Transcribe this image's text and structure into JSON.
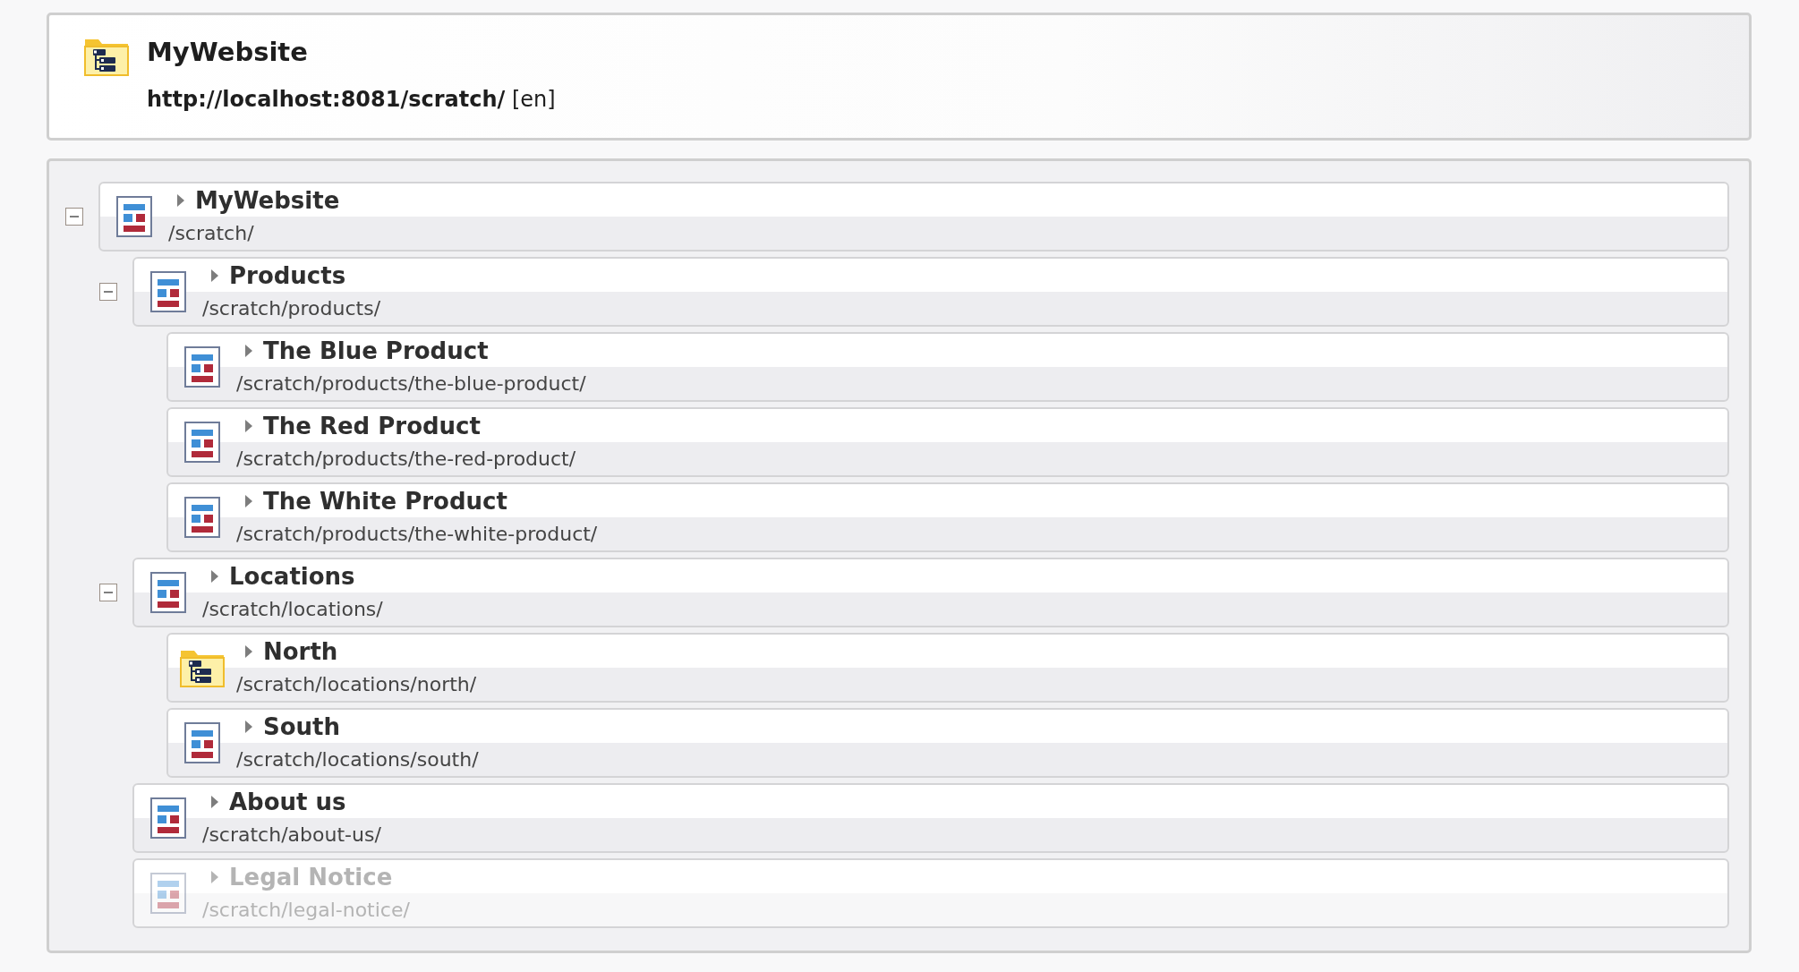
{
  "header": {
    "kind": "folder",
    "title": "MyWebsite",
    "url": "http://localhost:8081/scratch/",
    "language": "[en]"
  },
  "tree": [
    {
      "title": "MyWebsite",
      "path": "/scratch/",
      "kind": "page",
      "disabled": false,
      "expanded": true,
      "children": [
        {
          "title": "Products",
          "path": "/scratch/products/",
          "kind": "page",
          "disabled": false,
          "expanded": true,
          "children": [
            {
              "title": "The Blue Product",
              "path": "/scratch/products/the-blue-product/",
              "kind": "page",
              "disabled": false
            },
            {
              "title": "The Red Product",
              "path": "/scratch/products/the-red-product/",
              "kind": "page",
              "disabled": false
            },
            {
              "title": "The White Product",
              "path": "/scratch/products/the-white-product/",
              "kind": "page",
              "disabled": false
            }
          ]
        },
        {
          "title": "Locations",
          "path": "/scratch/locations/",
          "kind": "page",
          "disabled": false,
          "expanded": true,
          "children": [
            {
              "title": "North",
              "path": "/scratch/locations/north/",
              "kind": "folder",
              "disabled": false
            },
            {
              "title": "South",
              "path": "/scratch/locations/south/",
              "kind": "page",
              "disabled": false
            }
          ]
        },
        {
          "title": "About us",
          "path": "/scratch/about-us/",
          "kind": "page",
          "disabled": false
        },
        {
          "title": "Legal Notice",
          "path": "/scratch/legal-notice/",
          "kind": "page",
          "disabled": true
        }
      ]
    }
  ]
}
